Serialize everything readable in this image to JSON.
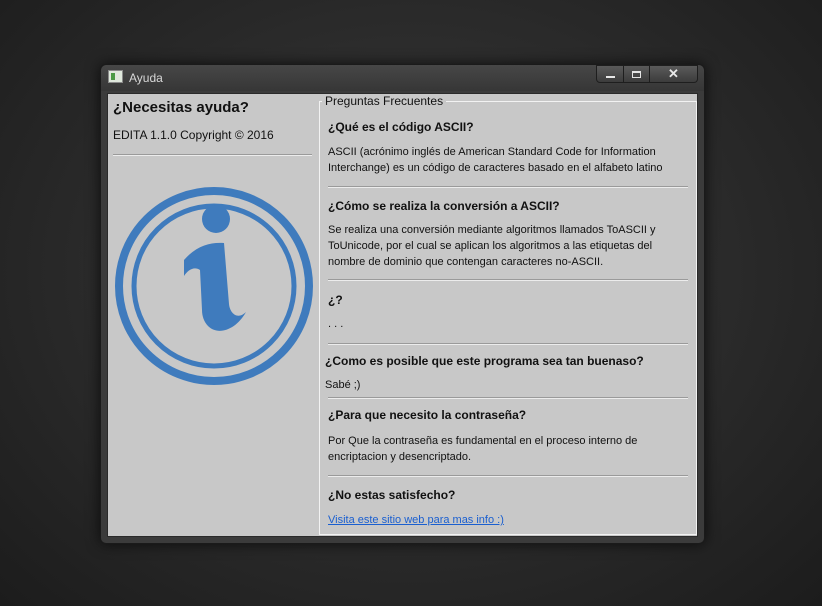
{
  "window": {
    "title": "Ayuda",
    "controls": {
      "minimize_icon": "minimize-icon",
      "maximize_icon": "maximize-icon",
      "close_icon": "close-icon",
      "close_glyph": "✕"
    }
  },
  "left_panel": {
    "heading": "¿Necesitas ayuda?",
    "version": "EDITA 1.1.0 Copyright © 2016",
    "icon": "info-icon",
    "icon_color": "#3f7bbd"
  },
  "faq": {
    "legend": "Preguntas Frecuentes",
    "items": [
      {
        "question": "¿Qué es el código ASCII?",
        "answer": "ASCII (acrónimo inglés de American Standard Code for Information Interchange) es un código de caracteres basado en el alfabeto latino"
      },
      {
        "question": "¿Cómo se realiza la conversión a ASCII?",
        "answer": "Se realiza una conversión mediante algoritmos llamados ToASCII y ToUnicode, por el cual se aplican los algoritmos a las etiquetas del nombre de dominio que contengan caracteres no-ASCII."
      },
      {
        "question": "¿?",
        "answer": ". . ."
      },
      {
        "question": "¿Como es posible que este programa sea tan buenaso?",
        "answer": "Sabé ;)"
      },
      {
        "question": "¿Para que necesito la contraseña?",
        "answer": "Por Que la contraseña es fundamental en el proceso interno de encriptacion y desencriptado."
      },
      {
        "question": "¿No estas satisfecho?",
        "link": "Visita este sitio web para mas info :)"
      }
    ]
  },
  "colors": {
    "link": "#1a5fd0",
    "panel_bg": "#c8c8c8"
  }
}
